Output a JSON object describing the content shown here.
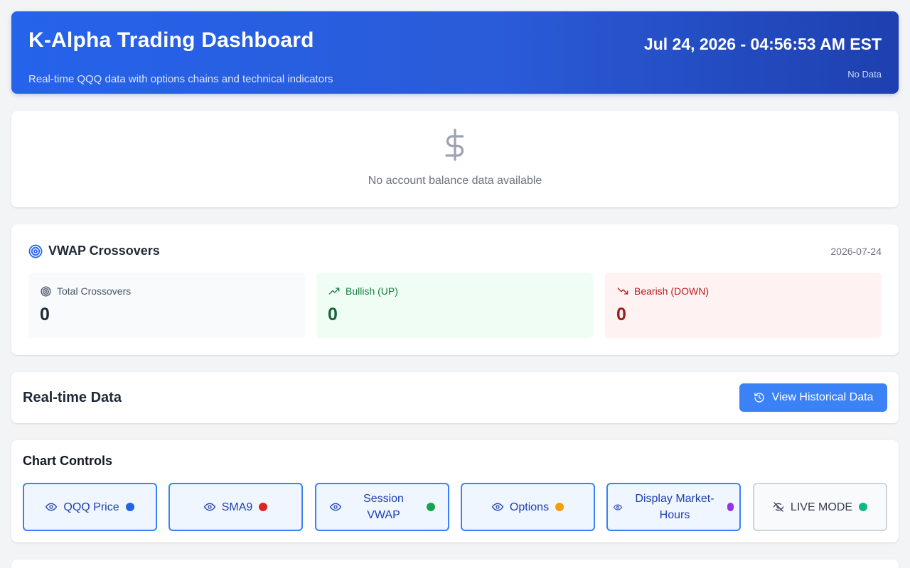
{
  "header": {
    "title": "K-Alpha Trading Dashboard",
    "subtitle": "Real-time QQQ data with options chains and technical indicators",
    "datetime": "Jul 24, 2026 - 04:56:53 AM EST",
    "status": "No Data"
  },
  "balance": {
    "icon": "dollar-sign-icon",
    "message": "No account balance data available"
  },
  "vwap": {
    "title": "VWAP Crossovers",
    "date": "2026-07-24",
    "stats": [
      {
        "label": "Total Crossovers",
        "value": "0",
        "icon": "target-icon"
      },
      {
        "label": "Bullish (UP)",
        "value": "0",
        "icon": "trending-up-icon"
      },
      {
        "label": "Bearish (DOWN)",
        "value": "0",
        "icon": "trending-down-icon"
      }
    ]
  },
  "realtime": {
    "title": "Real-time Data",
    "history_button": "View Historical Data"
  },
  "chart_controls": {
    "title": "Chart Controls",
    "toggles": [
      {
        "label": "QQQ Price",
        "color": "#2563eb",
        "active": true
      },
      {
        "label": "SMA9",
        "color": "#dc2626",
        "active": true
      },
      {
        "label": "Session VWAP",
        "color": "#16a34a",
        "active": true
      },
      {
        "label": "Options",
        "color": "#f59e0b",
        "active": true
      },
      {
        "label": "Display Market-Hours",
        "color": "#9333ea",
        "active": true
      },
      {
        "label": "LIVE MODE",
        "color": "#10b981",
        "active": false
      }
    ]
  }
}
